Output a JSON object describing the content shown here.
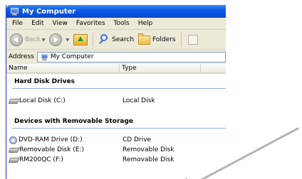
{
  "window": {
    "title": "My Computer"
  },
  "menu": [
    "File",
    "Edit",
    "View",
    "Favorites",
    "Tools",
    "Help"
  ],
  "toolbar": {
    "back_label": "Back",
    "search_label": "Search",
    "folders_label": "Folders"
  },
  "address": {
    "label": "Address",
    "value": "My Computer"
  },
  "columns": {
    "name": "Name",
    "type": "Type"
  },
  "groups": {
    "hard_disks": {
      "title": "Hard Disk Drives",
      "items": [
        {
          "name": "Local Disk (C:)",
          "type": "Local Disk",
          "icon": "hard-drive-icon"
        }
      ]
    },
    "removable": {
      "title": "Devices with Removable Storage",
      "items": [
        {
          "name": "DVD-RAM Drive (D:)",
          "type": "CD Drive",
          "icon": "cd-drive-icon"
        },
        {
          "name": "Removable Disk (E:)",
          "type": "Removable Disk",
          "icon": "removable-drive-icon"
        },
        {
          "name": "RM200QC (F:)",
          "type": "Removable Disk",
          "icon": "removable-drive-icon"
        }
      ]
    }
  },
  "colors": {
    "titlebar": "#0a52de",
    "window_bg": "#ece9d8",
    "group_rule": "#8bb0e8",
    "arrow": "#b4b4b4"
  }
}
